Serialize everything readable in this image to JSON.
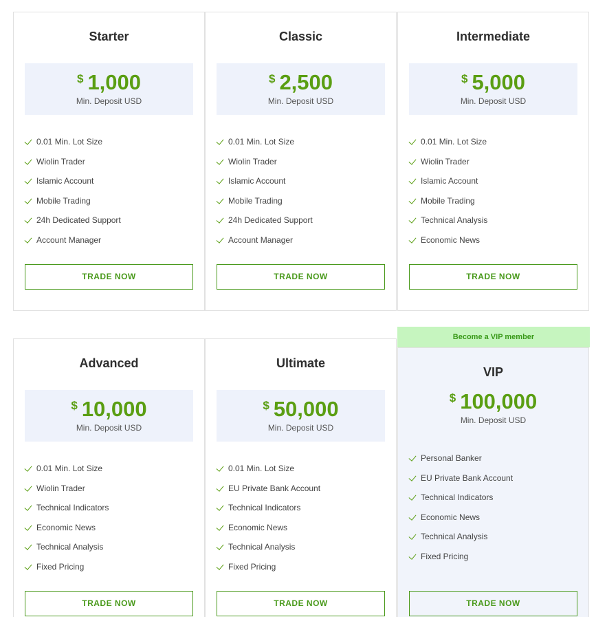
{
  "plans": [
    {
      "title": "Starter",
      "currency": "$",
      "amount": "1,000",
      "deposit_label": "Min. Deposit USD",
      "features": [
        "0.01 Min. Lot Size",
        "Wiolin Trader",
        "Islamic Account",
        "Mobile Trading",
        "24h Dedicated Support",
        "Account Manager"
      ],
      "button": "TRADE NOW"
    },
    {
      "title": "Classic",
      "currency": "$",
      "amount": "2,500",
      "deposit_label": "Min. Deposit USD",
      "features": [
        "0.01 Min. Lot Size",
        "Wiolin Trader",
        "Islamic Account",
        "Mobile Trading",
        "24h Dedicated Support",
        "Account Manager"
      ],
      "button": "TRADE NOW"
    },
    {
      "title": "Intermediate",
      "currency": "$",
      "amount": "5,000",
      "deposit_label": "Min. Deposit USD",
      "features": [
        "0.01 Min. Lot Size",
        "Wiolin Trader",
        "Islamic Account",
        "Mobile Trading",
        "Technical Analysis",
        "Economic News"
      ],
      "button": "TRADE NOW"
    },
    {
      "title": "Advanced",
      "currency": "$",
      "amount": "10,000",
      "deposit_label": "Min. Deposit USD",
      "features": [
        "0.01 Min. Lot Size",
        "Wiolin Trader",
        "Technical Indicators",
        "Economic News",
        "Technical Analysis",
        "Fixed Pricing"
      ],
      "button": "TRADE NOW"
    },
    {
      "title": "Ultimate",
      "currency": "$",
      "amount": "50,000",
      "deposit_label": "Min. Deposit USD",
      "features": [
        "0.01 Min. Lot Size",
        "EU Private Bank Account",
        "Technical Indicators",
        "Economic News",
        "Technical Analysis",
        "Fixed Pricing"
      ],
      "button": "TRADE NOW"
    },
    {
      "title": "VIP",
      "banner": "Become a VIP member",
      "currency": "$",
      "amount": "100,000",
      "deposit_label": "Min. Deposit USD",
      "features": [
        "Personal Banker",
        "EU Private Bank Account",
        "Technical Indicators",
        "Economic News",
        "Technical Analysis",
        "Fixed Pricing"
      ],
      "button": "TRADE NOW"
    }
  ],
  "colors": {
    "accent_green": "#5a9e12",
    "button_green": "#4a9a1c",
    "price_box_bg": "#eef2fb",
    "vip_banner_bg": "#c6f5bf",
    "vip_card_bg": "#f1f4fb"
  },
  "icons": {
    "feature_bullet": "check-icon"
  }
}
